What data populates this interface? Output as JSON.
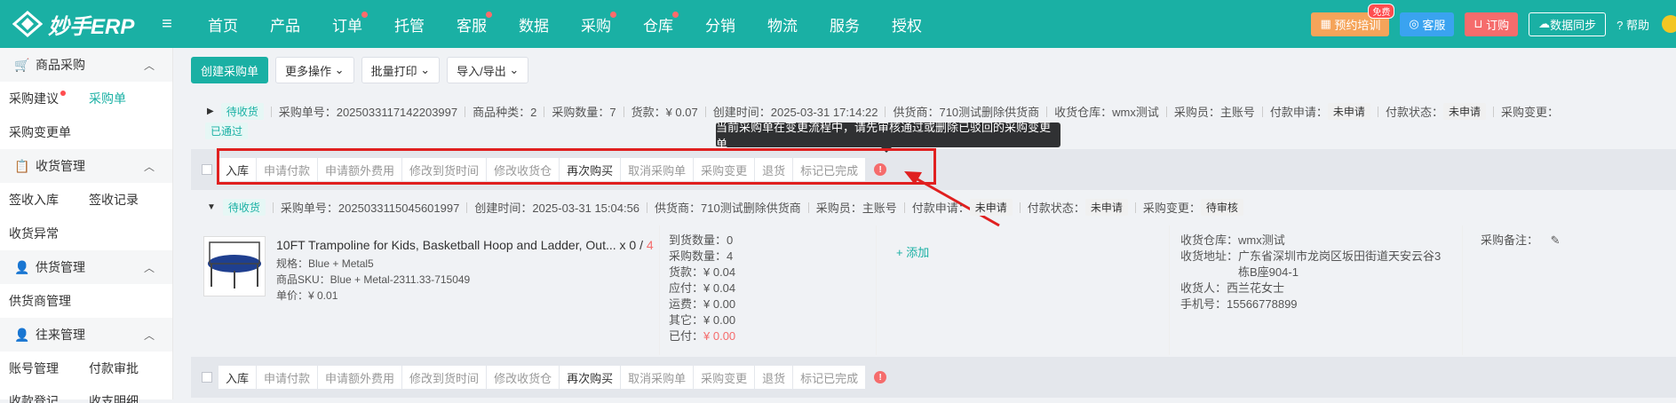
{
  "app": {
    "logo_text": "妙手ERP"
  },
  "nav": [
    {
      "label": "首页",
      "dot": false
    },
    {
      "label": "产品",
      "dot": false
    },
    {
      "label": "订单",
      "dot": true
    },
    {
      "label": "托管",
      "dot": false
    },
    {
      "label": "客服",
      "dot": true
    },
    {
      "label": "数据",
      "dot": false
    },
    {
      "label": "采购",
      "dot": true
    },
    {
      "label": "仓库",
      "dot": true
    },
    {
      "label": "分销",
      "dot": false
    },
    {
      "label": "物流",
      "dot": false
    },
    {
      "label": "服务",
      "dot": false
    },
    {
      "label": "授权",
      "dot": false
    }
  ],
  "top_right": {
    "training": "预约培训",
    "training_badge": "免费",
    "service": "客服",
    "order": "订购",
    "sync": "数据同步",
    "help": "帮助"
  },
  "sidebar": {
    "group1": "商品采购",
    "item_suggest": "采购建议",
    "item_order": "采购单",
    "item_change": "采购变更单",
    "group2": "收货管理",
    "item_sign_in": "签收入库",
    "item_sign_log": "签收记录",
    "item_exception": "收货异常",
    "group3": "供货管理",
    "item_supplier": "供货商管理",
    "group4": "往来管理",
    "item_account": "账号管理",
    "item_payment": "付款审批",
    "item_cut1": "收款登记",
    "item_cut2": "收支明细"
  },
  "toolbar": {
    "create": "创建采购单",
    "more": "更多操作",
    "print": "批量打印",
    "import_export": "导入/导出"
  },
  "order1": {
    "status": "待收货",
    "no": "采购单号：2025033117142203997",
    "kinds": "商品种类：2",
    "qty": "采购数量：7",
    "amount": "货款：¥ 0.07",
    "created": "创建时间：2025-03-31 17:14:22",
    "supplier": "供货商：710测试删除供货商",
    "warehouse": "收货仓库：wmx测试",
    "buyer": "采购员：主账号",
    "pay_apply_label": "付款申请：",
    "pay_apply": "未申请",
    "pay_status_label": "付款状态：",
    "pay_status": "未申请",
    "change_label": "采购变更：",
    "approved": "已通过"
  },
  "actions": [
    "入库",
    "申请付款",
    "申请额外费用",
    "修改到货时间",
    "修改收货仓",
    "再次购买",
    "取消采购单",
    "采购变更",
    "退货",
    "标记已完成"
  ],
  "tooltip": "当前采购单在变更流程中，请先审核通过或删除已驳回的采购变更单",
  "order2": {
    "status": "待收货",
    "no": "采购单号：2025033115045601997",
    "created": "创建时间：2025-03-31 15:04:56",
    "supplier": "供货商：710测试删除供货商",
    "buyer": "采购员：主账号",
    "pay_apply_label": "付款申请：",
    "pay_apply": "未申请",
    "pay_status_label": "付款状态：",
    "pay_status": "未申请",
    "change_label": "采购变更：",
    "change": "待审核"
  },
  "product": {
    "title": "10FT Trampoline for Kids, Basketball Hoop and Ladder, Out...",
    "qty_prefix": "x 0 /",
    "qty_total": "4",
    "spec": "规格：Blue + Metal5",
    "sku": "商品SKU：Blue + Metal-2311.33-715049",
    "price": "单价：¥ 0.01"
  },
  "amounts": {
    "arrived": "到货数量：0",
    "purchased": "采购数量：4",
    "goods": "货款：¥ 0.04",
    "payable": "应付：¥ 0.04",
    "freight": "运费：¥ 0.00",
    "other": "其它：¥ 0.00",
    "paid_label": "已付：",
    "paid": "¥ 0.00"
  },
  "add": "+ 添加",
  "receiver": {
    "warehouse": "收货仓库：wmx测试",
    "address_label": "收货地址：",
    "address1": "广东省深圳市龙岗区坂田街道天安云谷3",
    "address2": "栋B座904-1",
    "name": "收货人：西兰花女士",
    "phone": "手机号：15566778899"
  },
  "remark": "采购备注："
}
